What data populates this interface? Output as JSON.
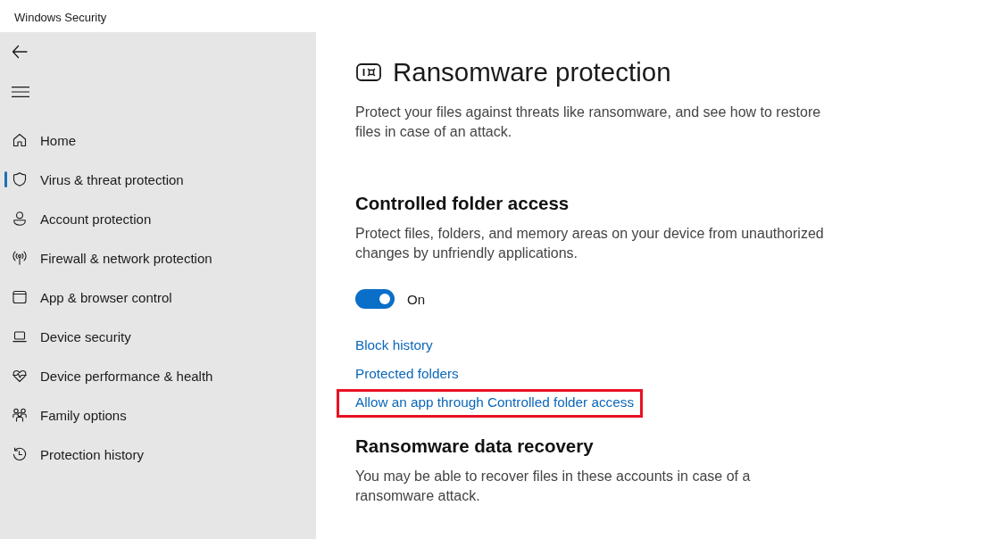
{
  "window": {
    "title": "Windows Security"
  },
  "sidebar": {
    "items": [
      {
        "label": "Home",
        "selected": false
      },
      {
        "label": "Virus & threat protection",
        "selected": true
      },
      {
        "label": "Account protection",
        "selected": false
      },
      {
        "label": "Firewall & network protection",
        "selected": false
      },
      {
        "label": "App & browser control",
        "selected": false
      },
      {
        "label": "Device security",
        "selected": false
      },
      {
        "label": "Device performance & health",
        "selected": false
      },
      {
        "label": "Family options",
        "selected": false
      },
      {
        "label": "Protection history",
        "selected": false
      }
    ]
  },
  "page": {
    "title": "Ransomware protection",
    "description": "Protect your files against threats like ransomware, and see how to restore files in case of an attack."
  },
  "sections": [
    {
      "heading": "Controlled folder access",
      "description": "Protect files, folders, and memory areas on your device from unauthorized changes by unfriendly applications.",
      "toggle": {
        "on": true,
        "label": "On"
      },
      "links": [
        {
          "label": "Block history",
          "highlighted": false
        },
        {
          "label": "Protected folders",
          "highlighted": false
        },
        {
          "label": "Allow an app through Controlled folder access",
          "highlighted": true
        }
      ]
    },
    {
      "heading": "Ransomware data recovery",
      "description": "You may be able to recover files in these accounts in case of a ransomware attack."
    }
  ]
}
